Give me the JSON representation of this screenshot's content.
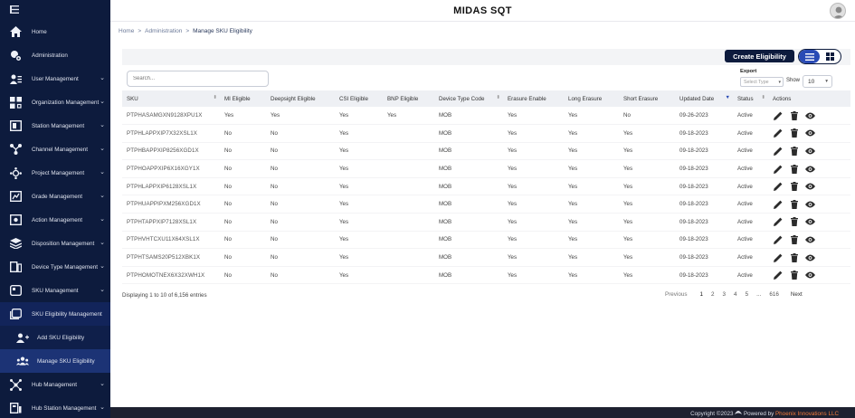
{
  "header": {
    "title": "MIDAS SQT"
  },
  "breadcrumb": {
    "home": "Home",
    "admin": "Administration",
    "current": "Manage SKU Eligibility",
    "sep": ">"
  },
  "sidebar": {
    "items": [
      {
        "label": "Home",
        "icon": "home-icon"
      },
      {
        "label": "Administration",
        "icon": "admin-gear-icon"
      },
      {
        "label": "User Management",
        "icon": "users-icon"
      },
      {
        "label": "Organization Management",
        "icon": "organization-icon"
      },
      {
        "label": "Station Management",
        "icon": "station-icon"
      },
      {
        "label": "Channel Management",
        "icon": "channel-icon"
      },
      {
        "label": "Project Management",
        "icon": "project-icon"
      },
      {
        "label": "Grade Management",
        "icon": "grade-icon"
      },
      {
        "label": "Action Management",
        "icon": "action-icon"
      },
      {
        "label": "Disposition Management",
        "icon": "disposition-icon"
      },
      {
        "label": "Device Type Management",
        "icon": "device-type-icon"
      },
      {
        "label": "SKU Management",
        "icon": "sku-icon"
      },
      {
        "label": "SKU Eligibility Management",
        "icon": "sku-eligibility-icon"
      }
    ],
    "sub_items": [
      {
        "label": "Add SKU Eligibility",
        "icon": "add-user-icon"
      },
      {
        "label": "Manage SKU Eligibility",
        "icon": "manage-users-icon"
      }
    ],
    "bottom_items": [
      {
        "label": "Hub Management",
        "icon": "hub-icon"
      },
      {
        "label": "Hub Station Management",
        "icon": "hub-station-icon"
      }
    ]
  },
  "toolbar": {
    "create_label": "Create Eligibility",
    "search_placeholder": "Search...",
    "export_label": "Export",
    "select_type_placeholder": "Select Type",
    "show_label": "Show",
    "show_value": "10"
  },
  "table": {
    "columns": [
      "SKU",
      "MI Eligible",
      "Deepsight Eligible",
      "CSI Eligible",
      "BNP Eligible",
      "Device Type Code",
      "Erasure Enable",
      "Long Erasure",
      "Short Erasure",
      "Updated Date",
      "Status",
      "Actions"
    ],
    "rows": [
      [
        "PTPHASAMGXN9128XPU1X",
        "Yes",
        "Yes",
        "Yes",
        "Yes",
        "MOB",
        "Yes",
        "Yes",
        "No",
        "09-26-2023",
        "Active"
      ],
      [
        "PTPHLAPPXIP7X32XSL1X",
        "No",
        "No",
        "Yes",
        "",
        "MOB",
        "Yes",
        "Yes",
        "Yes",
        "09-18-2023",
        "Active"
      ],
      [
        "PTPHBAPPXIP8256XGD1X",
        "No",
        "No",
        "Yes",
        "",
        "MOB",
        "Yes",
        "Yes",
        "Yes",
        "09-18-2023",
        "Active"
      ],
      [
        "PTPHOAPPXIP6X16XGY1X",
        "No",
        "No",
        "Yes",
        "",
        "MOB",
        "Yes",
        "Yes",
        "Yes",
        "09-18-2023",
        "Active"
      ],
      [
        "PTPHLAPPXIP6128XSL1X",
        "No",
        "No",
        "Yes",
        "",
        "MOB",
        "Yes",
        "Yes",
        "Yes",
        "09-18-2023",
        "Active"
      ],
      [
        "PTPHUAPPIPXM256XGD1X",
        "No",
        "No",
        "Yes",
        "",
        "MOB",
        "Yes",
        "Yes",
        "Yes",
        "09-18-2023",
        "Active"
      ],
      [
        "PTPHTAPPXIP7128XSL1X",
        "No",
        "No",
        "Yes",
        "",
        "MOB",
        "Yes",
        "Yes",
        "Yes",
        "09-18-2023",
        "Active"
      ],
      [
        "PTPHVHTCXU11X64XSL1X",
        "No",
        "No",
        "Yes",
        "",
        "MOB",
        "Yes",
        "Yes",
        "Yes",
        "09-18-2023",
        "Active"
      ],
      [
        "PTPHTSAMS20P512XBK1X",
        "No",
        "No",
        "Yes",
        "",
        "MOB",
        "Yes",
        "Yes",
        "Yes",
        "09-18-2023",
        "Active"
      ],
      [
        "PTPHOMOTNEX6X32XWH1X",
        "No",
        "No",
        "Yes",
        "",
        "MOB",
        "Yes",
        "Yes",
        "Yes",
        "09-18-2023",
        "Active"
      ]
    ]
  },
  "footer": {
    "entries_info": "Displaying 1 to 10 of 6,156 entries",
    "pagination": {
      "prev": "Previous",
      "pages": [
        "1",
        "2",
        "3",
        "4",
        "5",
        "...",
        "616"
      ],
      "next": "Next"
    },
    "copyright_prefix": "Copyright ©2023",
    "copyright_powered": "Powered by",
    "copyright_brand": "Phoenix Innovations LLC"
  },
  "colors": {
    "sidebar_bg": "#0d1b3d",
    "accent": "#2a4bb5",
    "brand_orange": "#f07a3a",
    "bottom_bar": "#1e2130"
  }
}
